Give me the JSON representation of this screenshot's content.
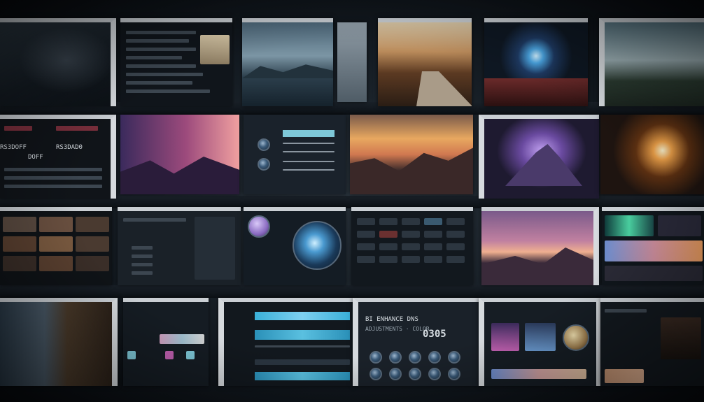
{
  "screens": {
    "editor_text_line1": "BI ENHANCE DNS",
    "editor_text_line2": "ADJUSTMENTS · COLOR",
    "editor_big_number": "0305",
    "list_label_a": "RS3DOFF",
    "list_label_b": "RS3DAD0",
    "list_label_c": "DOFF"
  },
  "colors": {
    "accent_cyan": "#7ec8d8",
    "accent_purple": "#8a6bc2",
    "accent_orange": "#f0a34a",
    "panel_dark": "#151b22",
    "frame_light": "#c9ced3"
  }
}
